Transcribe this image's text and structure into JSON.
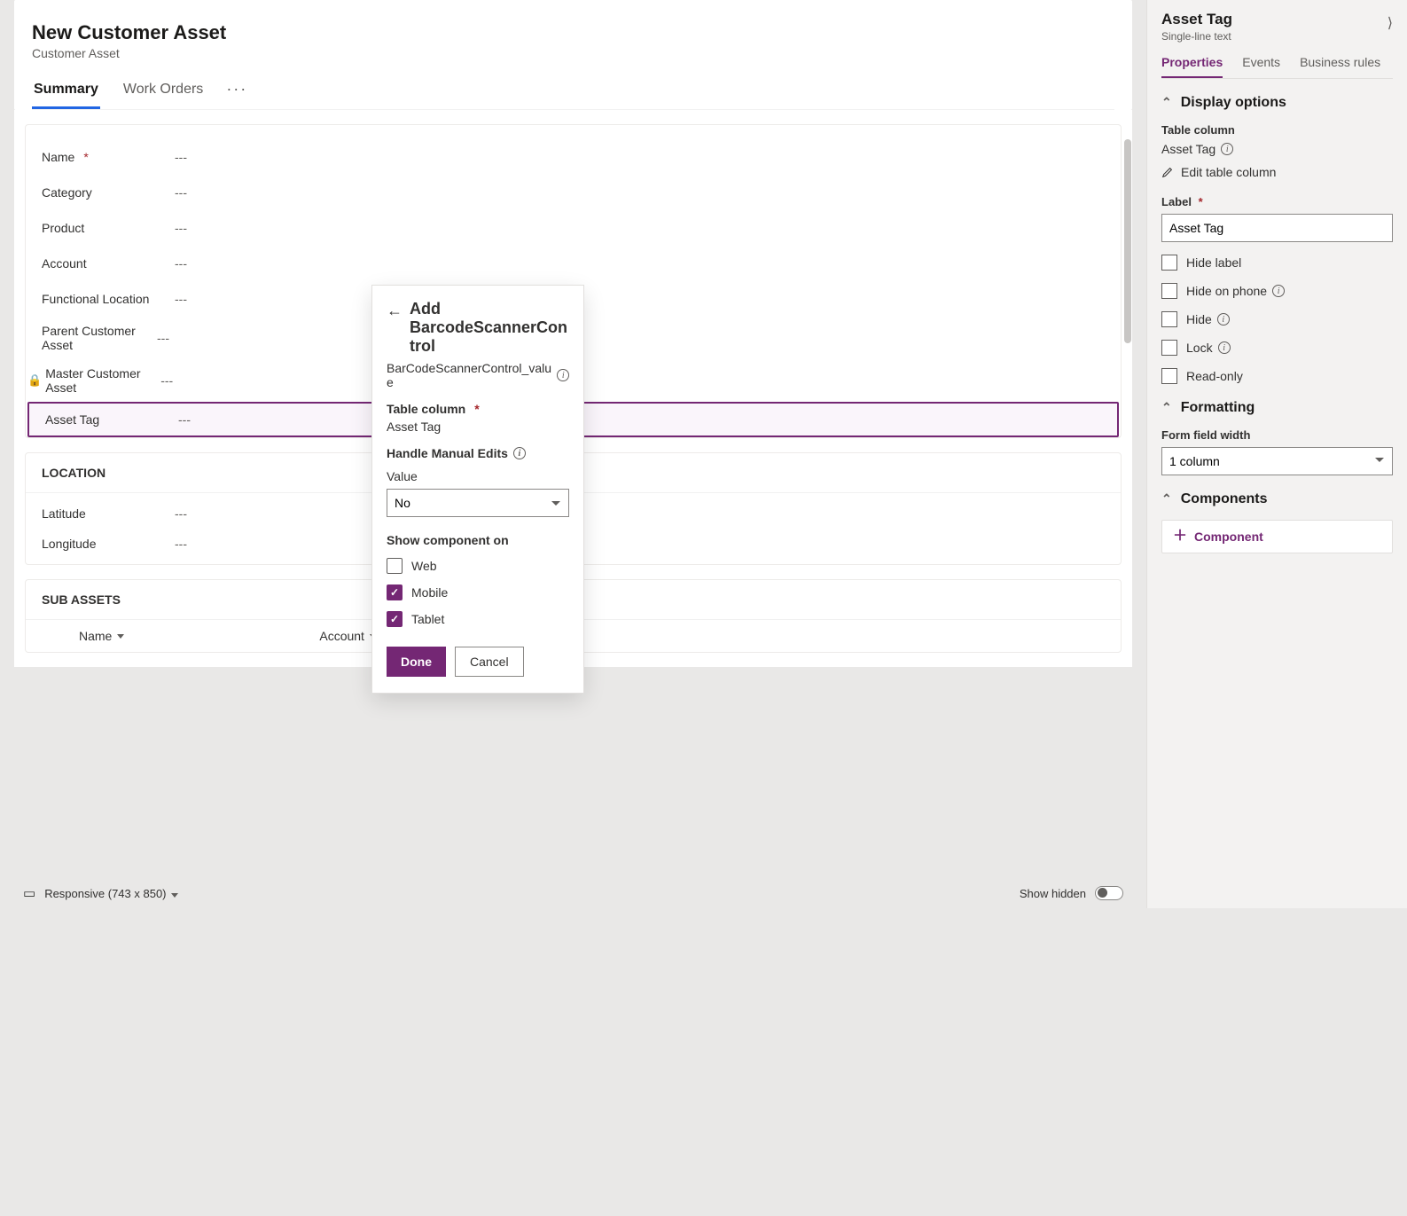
{
  "form": {
    "title": "New Customer Asset",
    "subtitle": "Customer Asset",
    "tabs": [
      {
        "label": "Summary",
        "active": true
      },
      {
        "label": "Work Orders",
        "active": false
      }
    ],
    "fields": [
      {
        "label": "Name",
        "required": true,
        "value": "---",
        "locked": false
      },
      {
        "label": "Category",
        "required": false,
        "value": "---",
        "locked": false
      },
      {
        "label": "Product",
        "required": false,
        "value": "---",
        "locked": false
      },
      {
        "label": "Account",
        "required": false,
        "value": "---",
        "locked": false
      },
      {
        "label": "Functional Location",
        "required": false,
        "value": "---",
        "locked": false
      },
      {
        "label": "Parent Customer Asset",
        "required": false,
        "value": "---",
        "locked": false
      },
      {
        "label": "Master Customer Asset",
        "required": false,
        "value": "---",
        "locked": true
      },
      {
        "label": "Asset Tag",
        "required": false,
        "value": "---",
        "locked": false,
        "selected": true
      }
    ],
    "location_header": "LOCATION",
    "location_fields": [
      {
        "label": "Latitude",
        "value": "---"
      },
      {
        "label": "Longitude",
        "value": "---"
      }
    ],
    "subassets_header": "SUB ASSETS",
    "subassets_columns": [
      {
        "label": "Name"
      },
      {
        "label": "Account"
      }
    ]
  },
  "bottom_bar": {
    "mode": "Responsive",
    "dimensions": "(743 x 850)",
    "show_hidden": "Show hidden"
  },
  "popover": {
    "title_prefix": "Add",
    "title_main": "BarcodeScannerControl",
    "subtitle": "BarCodeScannerControl_value",
    "table_column_label": "Table column",
    "table_column_value": "Asset Tag",
    "handle_manual_label": "Handle Manual Edits",
    "value_label": "Value",
    "value_selected": "No",
    "show_on_label": "Show component on",
    "checks": [
      {
        "label": "Web",
        "checked": false
      },
      {
        "label": "Mobile",
        "checked": true
      },
      {
        "label": "Tablet",
        "checked": true
      }
    ],
    "done": "Done",
    "cancel": "Cancel"
  },
  "panel": {
    "title": "Asset Tag",
    "subtitle": "Single-line text",
    "tabs": [
      {
        "label": "Properties",
        "active": true
      },
      {
        "label": "Events",
        "active": false
      },
      {
        "label": "Business rules",
        "active": false
      }
    ],
    "sections": {
      "display": {
        "header": "Display options",
        "table_column_label": "Table column",
        "table_column_value": "Asset Tag",
        "edit_link": "Edit table column",
        "label_label": "Label",
        "label_value": "Asset Tag",
        "checks": [
          {
            "label": "Hide label",
            "info": false
          },
          {
            "label": "Hide on phone",
            "info": true
          },
          {
            "label": "Hide",
            "info": true
          },
          {
            "label": "Lock",
            "info": true
          },
          {
            "label": "Read-only",
            "info": false
          }
        ]
      },
      "formatting": {
        "header": "Formatting",
        "width_label": "Form field width",
        "width_value": "1 column"
      },
      "components": {
        "header": "Components",
        "add": "Component"
      }
    }
  }
}
